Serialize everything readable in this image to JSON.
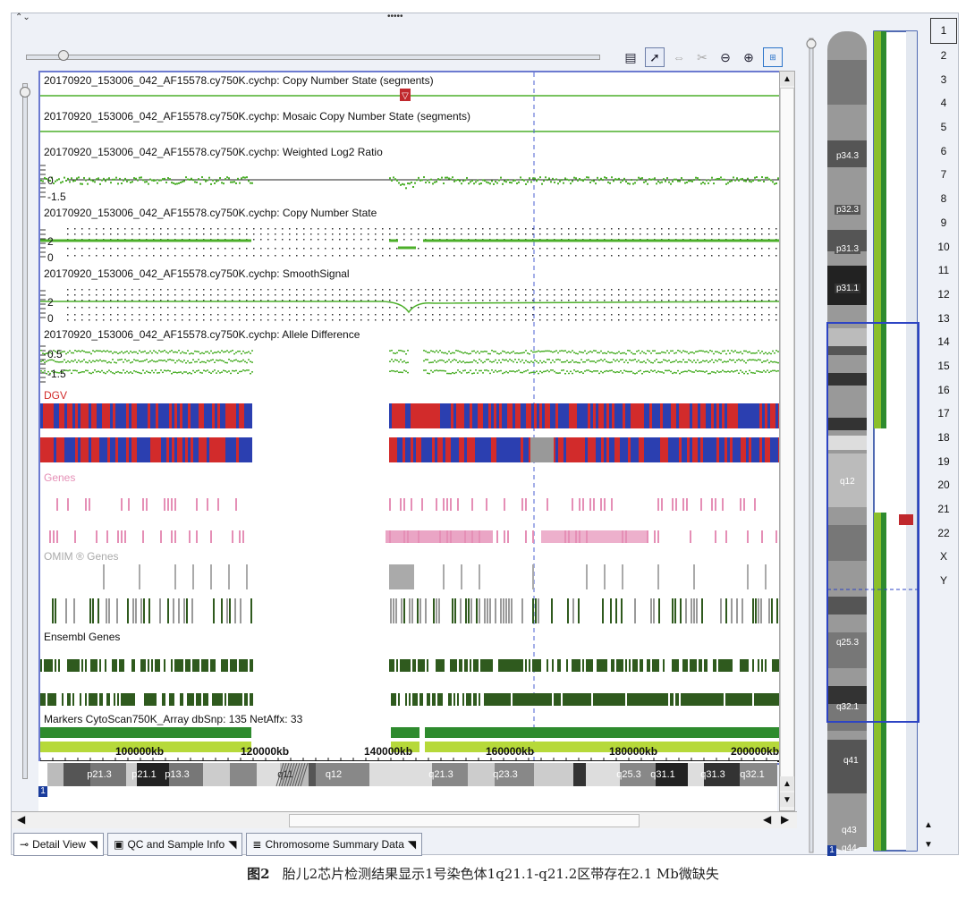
{
  "window": {
    "collapse_arrows": "⌃⌄",
    "grip": "•••••"
  },
  "toolbar": {
    "icons": [
      "export-icon",
      "pointer-icon",
      "pan-icon",
      "clear-icon",
      "zoom-out-icon",
      "zoom-in-icon",
      "zoom-fit-icon"
    ]
  },
  "tracks": [
    {
      "label": "20170920_153006_042_AF15578.cy750K.cychp: Copy Number State (segments)"
    },
    {
      "label": "20170920_153006_042_AF15578.cy750K.cychp: Mosaic Copy Number State (segments)"
    },
    {
      "label": "20170920_153006_042_AF15578.cy750K.cychp: Weighted Log2 Ratio"
    },
    {
      "label": "20170920_153006_042_AF15578.cy750K.cychp: Copy Number State"
    },
    {
      "label": "20170920_153006_042_AF15578.cy750K.cychp: SmoothSignal"
    },
    {
      "label": "20170920_153006_042_AF15578.cy750K.cychp: Allele Difference"
    }
  ],
  "axis_ticks": {
    "log2": [
      "0",
      "-1.5"
    ],
    "cn": [
      "2",
      "0"
    ],
    "smooth": [
      "2",
      "0"
    ],
    "allele": [
      "0.5",
      "-1.5"
    ]
  },
  "sections": {
    "dgv": "DGV",
    "genes": "Genes",
    "omim": "OMIM ® Genes",
    "ensembl": "Ensembl Genes",
    "markers": "Markers CytoScan750K_Array dbSnp: 135 NetAffx: 33"
  },
  "genome_axis": {
    "labels": [
      "100000kb",
      "120000kb",
      "140000kb",
      "160000kb",
      "180000kb",
      "200000kb"
    ]
  },
  "ideogram_bands": [
    "p21.3",
    "p21.1",
    "p13.3",
    "q11",
    "q12",
    "q21.3",
    "q23.3",
    "q25.3",
    "q31.1",
    "q31.3",
    "q32.1"
  ],
  "ideogram_chrom": "1",
  "tabs": [
    {
      "label": "Detail View"
    },
    {
      "label": "QC and Sample Info"
    },
    {
      "label": "Chromosome Summary Data"
    }
  ],
  "chromosome_overview": {
    "bands": [
      "p34.3",
      "p32.3",
      "p31.3",
      "p31.1",
      "q12",
      "q25.3",
      "q32.1",
      "q41",
      "q43",
      "q44"
    ],
    "chrom": "1",
    "numbers": [
      "1",
      "2",
      "3",
      "4",
      "5",
      "6",
      "7",
      "8",
      "9",
      "10",
      "11",
      "12",
      "13",
      "14",
      "15",
      "16",
      "17",
      "18",
      "19",
      "20",
      "21",
      "22",
      "X",
      "Y"
    ],
    "selected": "1"
  },
  "caption": {
    "figure": "图2",
    "text": "胎儿2芯片检测结果显示1号染色体1q21.1-q21.2区带存在2.1 Mb微缺失"
  },
  "colors": {
    "signal_green": "#4caf2a",
    "dgv_red": "#d22b2b",
    "dgv_blue": "#2b3fb0",
    "genes_pink": "#e58fb6",
    "ensembl_green": "#2f5a1e",
    "marker_green": "#2e8b2e",
    "marker_lime": "#b6d93a",
    "deletion_flag": "#c0282d"
  }
}
